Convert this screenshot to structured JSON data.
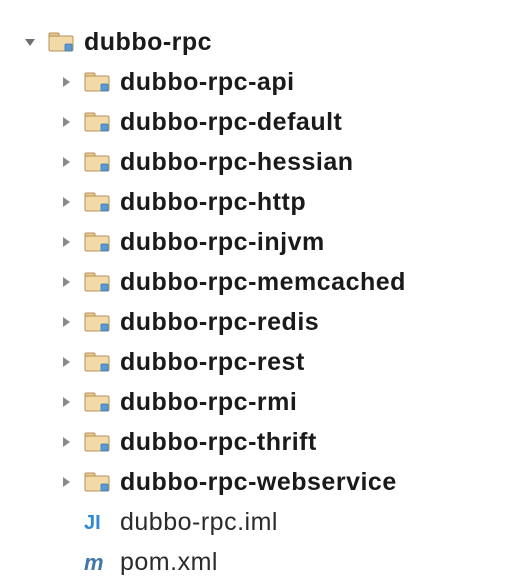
{
  "tree": {
    "root": {
      "label": "dubbo-rpc",
      "expanded": true,
      "type": "module-folder"
    },
    "children": [
      {
        "label": "dubbo-rpc-api",
        "expanded": false,
        "type": "module-folder",
        "bold": true
      },
      {
        "label": "dubbo-rpc-default",
        "expanded": false,
        "type": "module-folder",
        "bold": true
      },
      {
        "label": "dubbo-rpc-hessian",
        "expanded": false,
        "type": "module-folder",
        "bold": true
      },
      {
        "label": "dubbo-rpc-http",
        "expanded": false,
        "type": "module-folder",
        "bold": true
      },
      {
        "label": "dubbo-rpc-injvm",
        "expanded": false,
        "type": "module-folder",
        "bold": true
      },
      {
        "label": "dubbo-rpc-memcached",
        "expanded": false,
        "type": "module-folder",
        "bold": true
      },
      {
        "label": "dubbo-rpc-redis",
        "expanded": false,
        "type": "module-folder",
        "bold": true
      },
      {
        "label": "dubbo-rpc-rest",
        "expanded": false,
        "type": "module-folder",
        "bold": true
      },
      {
        "label": "dubbo-rpc-rmi",
        "expanded": false,
        "type": "module-folder",
        "bold": true
      },
      {
        "label": "dubbo-rpc-thrift",
        "expanded": false,
        "type": "module-folder",
        "bold": true
      },
      {
        "label": "dubbo-rpc-webservice",
        "expanded": false,
        "type": "module-folder",
        "bold": true
      },
      {
        "label": "dubbo-rpc.iml",
        "expanded": null,
        "type": "iml-file",
        "bold": false
      },
      {
        "label": "pom.xml",
        "expanded": null,
        "type": "pom-file",
        "bold": false
      }
    ]
  }
}
